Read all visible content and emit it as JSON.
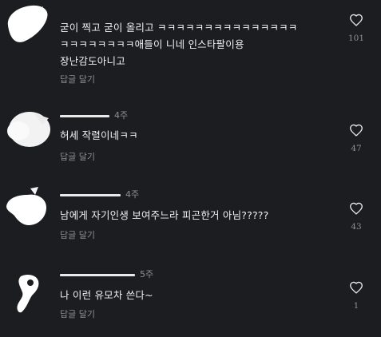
{
  "comments": [
    {
      "time": "",
      "lines": [
        "굳이 찍고 굳이 올리고 ㅋㅋㅋㅋㅋㅋㅋㅋㅋㅋㅋㅋㅋㅋㅋ",
        "ㅋㅋㅋㅋㅋㅋㅋㅋ애들이 니네 인스타팔이용",
        "장난감도아니고"
      ],
      "reply_label": "답글 달기",
      "likes": "101"
    },
    {
      "time": "4주",
      "lines": [
        "허세 작렬이네ㅋㅋ"
      ],
      "reply_label": "답글 달기",
      "likes": "47"
    },
    {
      "time": "4주",
      "lines": [
        "남에게 자기인생 보여주느라  피곤한거 아님?????"
      ],
      "reply_label": "답글 달기",
      "likes": "43"
    },
    {
      "time": "5주",
      "lines": [
        "나 이런 유모차 쓴다~"
      ],
      "reply_label": "답글 달기",
      "likes": "1"
    }
  ],
  "icons": {
    "like": "heart-outline-icon"
  },
  "colors": {
    "background": "#1c1d21",
    "text": "#f0f1f3",
    "muted": "#8d9096"
  }
}
